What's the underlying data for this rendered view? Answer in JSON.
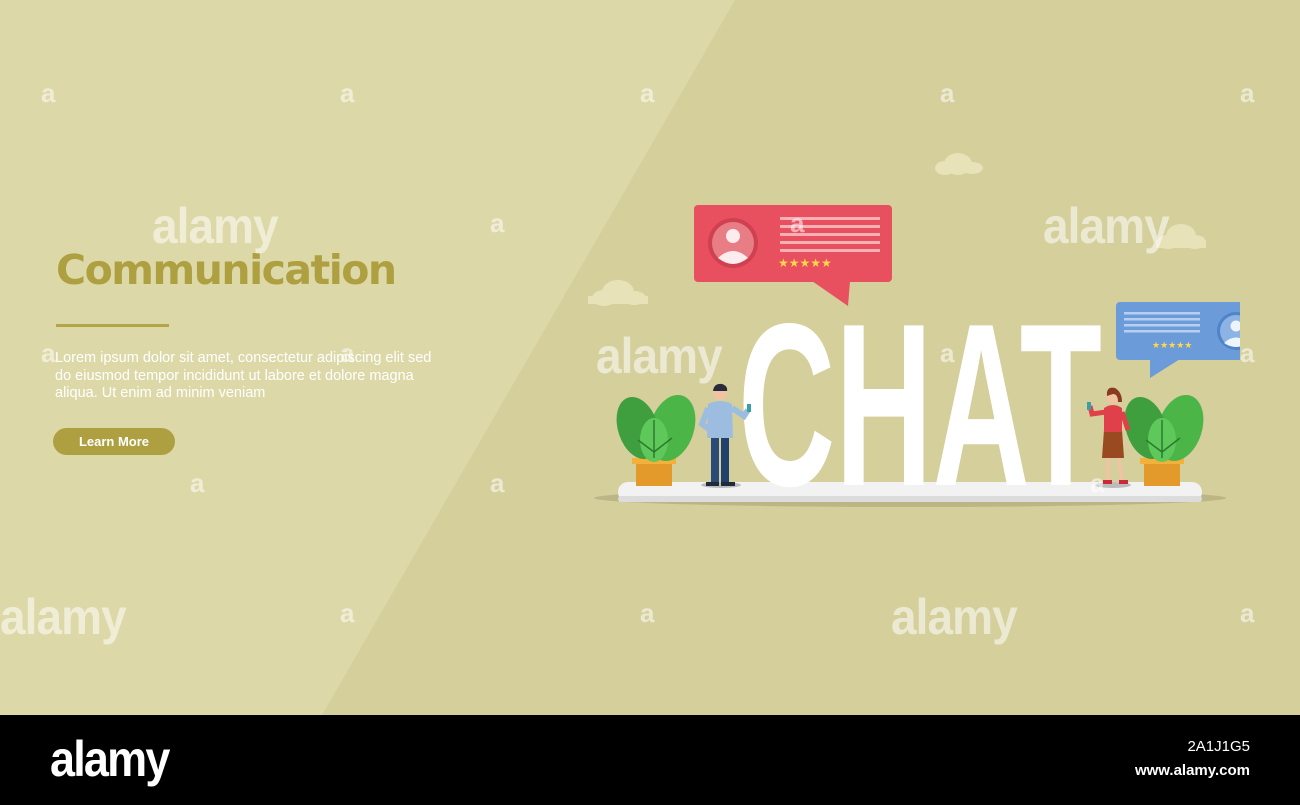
{
  "hero": {
    "headline": "Communication",
    "body": "Lorem ipsum dolor sit amet, consectetur adipiscing elit sed do eiusmod tempor incididunt ut labore et dolore magna aliqua. Ut enim ad minim veniam",
    "cta_label": "Learn More"
  },
  "illustration": {
    "word": "CHAT",
    "rating_stars": "★★★★★",
    "icons": [
      "avatar-icon",
      "cloud-icon",
      "plant-icon",
      "rating-star-icon"
    ]
  },
  "watermark": {
    "text": "alamy",
    "letter": "a"
  },
  "footer": {
    "logo": "alamy",
    "image_id": "2A1J1G5",
    "url": "www.alamy.com"
  },
  "colors": {
    "background": "#d5cf9c",
    "accent": "#aea040",
    "bubble_red": "#e8505f",
    "bubble_blue": "#6b9bd8",
    "footer": "#000000"
  }
}
